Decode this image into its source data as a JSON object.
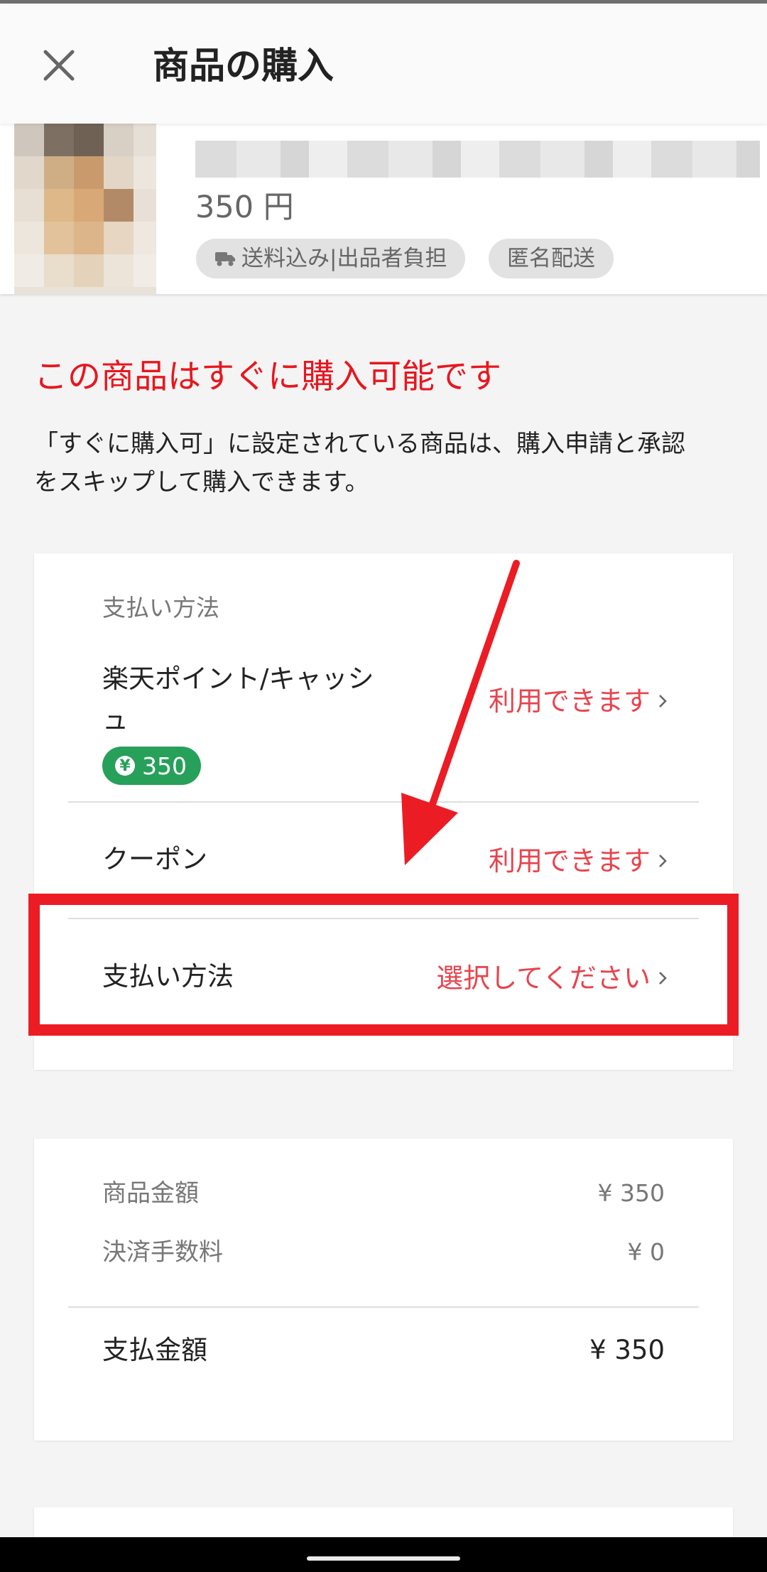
{
  "header": {
    "title": "商品の購入",
    "close_icon": "close-icon"
  },
  "product": {
    "price": "350 円",
    "shipping_tag": "送料込み|出品者負担",
    "anonymous_tag": "匿名配送",
    "shipping_icon": "truck-icon"
  },
  "notice": {
    "title": "この商品はすぐに購入可能です",
    "line1": "「すぐに購入可」に設定されている商品は、購入申請と承認",
    "line2": "をスキップして購入できます。"
  },
  "payment": {
    "section_label": "支払い方法",
    "points": {
      "label_line1": "楽天ポイント/キャッシ",
      "label_line2": "ュ",
      "badge_value": "350",
      "badge_symbol": "¥",
      "status": "利用できます"
    },
    "coupon": {
      "label": "クーポン",
      "status": "利用できます"
    },
    "method": {
      "label": "支払い方法",
      "status": "選択してください"
    }
  },
  "summary": {
    "item_price_label": "商品金額",
    "item_price_value": "¥ 350",
    "fee_label": "決済手数料",
    "fee_value": "¥ 0",
    "total_label": "支払金額",
    "total_value": "¥ 350"
  },
  "colors": {
    "accent_red": "#e8444d",
    "notice_red": "#e8161e",
    "annotation_red": "#ec1c24",
    "points_green": "#27a05a"
  }
}
